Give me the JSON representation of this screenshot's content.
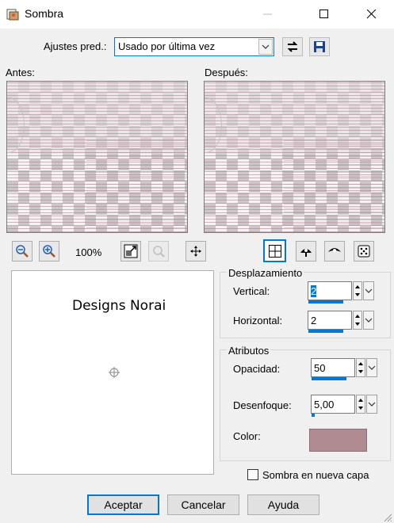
{
  "window": {
    "title": "Sombra"
  },
  "presets": {
    "label": "Ajustes pred.:",
    "value": "Usado por última vez"
  },
  "preview": {
    "before_label": "Antes:",
    "after_label": "Después:",
    "zoom": "100%"
  },
  "canvas": {
    "text": "Designs Norai"
  },
  "offset": {
    "title": "Desplazamiento",
    "vertical_label": "Vertical:",
    "vertical_value": "2",
    "horizontal_label": "Horizontal:",
    "horizontal_value": "2"
  },
  "attributes": {
    "title": "Atributos",
    "opacity_label": "Opacidad:",
    "opacity_value": "50",
    "blur_label": "Desenfoque:",
    "blur_value": "5,00",
    "color_label": "Color:",
    "color_value": "#b08c92"
  },
  "new_layer_label": "Sombra en nueva capa",
  "buttons": {
    "ok": "Aceptar",
    "cancel": "Cancelar",
    "help": "Ayuda"
  }
}
